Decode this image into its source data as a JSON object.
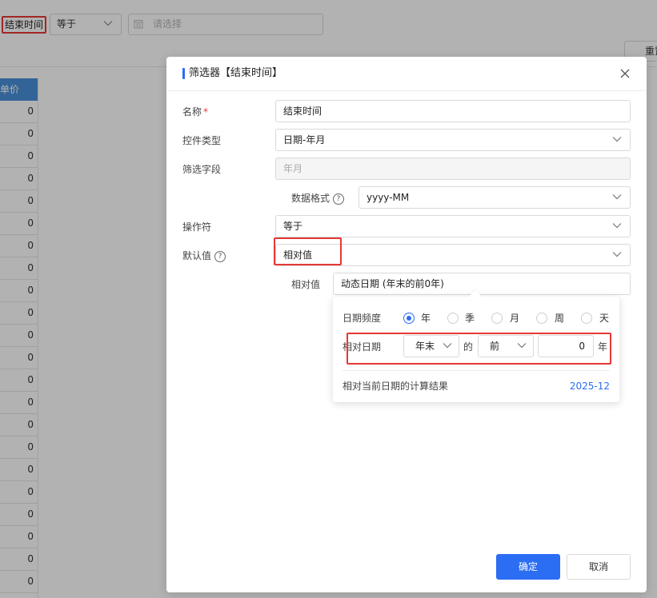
{
  "background": {
    "filter_tag": "结束时间",
    "operator_value": "等于",
    "date_placeholder": "请选择",
    "reset_button": "重置",
    "table_header": "单价",
    "table_values": [
      "0",
      "0",
      "0",
      "0",
      "0",
      "0",
      "0",
      "0",
      "0",
      "0",
      "0",
      "0",
      "0",
      "0",
      "0",
      "0",
      "0",
      "0",
      "0",
      "0",
      "0",
      "0"
    ]
  },
  "modal": {
    "title": "筛选器【结束时间】",
    "fields": {
      "name_label": "名称",
      "name_required_mark": "*",
      "name_value": "结束时间",
      "control_type_label": "控件类型",
      "control_type_value": "日期-年月",
      "filter_field_label": "筛选字段",
      "filter_field_value": "年月",
      "data_format_label": "数据格式",
      "data_format_value": "yyyy-MM",
      "operator_label": "操作符",
      "operator_value": "等于",
      "default_value_label": "默认值",
      "default_value_value": "相对值",
      "relative_value_label": "相对值",
      "relative_value_value": "动态日期 (年末的前0年)"
    },
    "popover": {
      "frequency_label": "日期频度",
      "frequency_options": [
        "年",
        "季",
        "月",
        "周",
        "天"
      ],
      "frequency_selected": "年",
      "relative_date_label": "相对日期",
      "anchor_value": "年末",
      "of_text": "的",
      "direction_value": "前",
      "offset_value": "0",
      "unit_text": "年",
      "result_label": "相对当前日期的计算结果",
      "result_value": "2025-12"
    },
    "buttons": {
      "confirm": "确定",
      "cancel": "取消"
    }
  },
  "colors": {
    "accent": "#2b6df3",
    "highlight_box": "#e53935",
    "table_header_bg": "#4a90d9"
  }
}
